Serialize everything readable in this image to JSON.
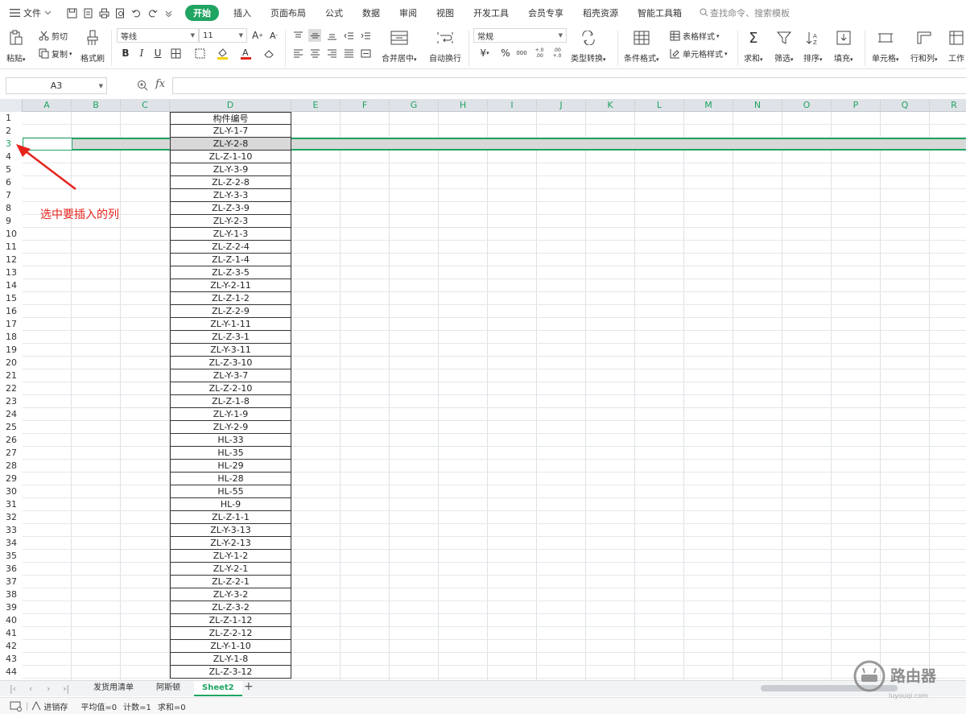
{
  "menubar": {
    "file_label": "文件",
    "tabs": [
      "开始",
      "插入",
      "页面布局",
      "公式",
      "数据",
      "审阅",
      "视图",
      "开发工具",
      "会员专享",
      "稻壳资源",
      "智能工具箱"
    ],
    "active_tab": "开始",
    "search_placeholder": "查找命令、搜索模板"
  },
  "ribbon": {
    "paste": "粘贴",
    "cut": "剪切",
    "copy": "复制",
    "format_painter": "格式刷",
    "font_name": "等线",
    "font_size": "11",
    "merge_center": "合并居中",
    "wrap_text": "自动换行",
    "number_format": "常规",
    "type_convert": "类型转换",
    "conditional_format": "条件格式",
    "table_style": "表格样式",
    "cell_style": "单元格样式",
    "sum": "求和",
    "filter": "筛选",
    "sort": "排序",
    "fill": "填充",
    "cell": "单元格",
    "rows_cols": "行和列",
    "worksheet": "工作",
    "bold": "B",
    "italic": "I",
    "underline": "U",
    "currency": "¥",
    "percent": "%",
    "thousands": "000",
    "inc_decimal": "+.0 .00",
    "dec_decimal": ".00 +.0"
  },
  "formula_bar": {
    "name_box": "A3",
    "fx": "fx",
    "value": ""
  },
  "grid": {
    "columns": [
      "A",
      "B",
      "C",
      "D",
      "E",
      "F",
      "G",
      "H",
      "I",
      "J",
      "K",
      "L",
      "M",
      "N",
      "O",
      "P",
      "Q",
      "R"
    ],
    "rows": [
      "1",
      "2",
      "3",
      "4",
      "5",
      "6",
      "7",
      "8",
      "9",
      "10",
      "11",
      "12",
      "13",
      "14",
      "15",
      "16",
      "17",
      "18",
      "19",
      "20",
      "21",
      "22",
      "23",
      "24",
      "25",
      "26",
      "27",
      "28",
      "29",
      "30",
      "31",
      "32",
      "33",
      "34",
      "35",
      "36",
      "37",
      "38",
      "39",
      "40",
      "41",
      "42",
      "43",
      "44"
    ],
    "column_d_values": [
      "构件编号",
      "ZL-Y-1-7",
      "ZL-Y-2-8",
      "ZL-Z-1-10",
      "ZL-Y-3-9",
      "ZL-Z-2-8",
      "ZL-Y-3-3",
      "ZL-Z-3-9",
      "ZL-Y-2-3",
      "ZL-Y-1-3",
      "ZL-Z-2-4",
      "ZL-Z-1-4",
      "ZL-Z-3-5",
      "ZL-Y-2-11",
      "ZL-Z-1-2",
      "ZL-Z-2-9",
      "ZL-Y-1-11",
      "ZL-Z-3-1",
      "ZL-Y-3-11",
      "ZL-Z-3-10",
      "ZL-Y-3-7",
      "ZL-Z-2-10",
      "ZL-Z-1-8",
      "ZL-Y-1-9",
      "ZL-Y-2-9",
      "HL-33",
      "HL-35",
      "HL-29",
      "HL-28",
      "HL-55",
      "HL-9",
      "ZL-Z-1-1",
      "ZL-Y-3-13",
      "ZL-Y-2-13",
      "ZL-Y-1-2",
      "ZL-Y-2-1",
      "ZL-Z-2-1",
      "ZL-Y-3-2",
      "ZL-Z-3-2",
      "ZL-Z-1-12",
      "ZL-Z-2-12",
      "ZL-Y-1-10",
      "ZL-Y-1-8",
      "ZL-Z-3-12"
    ],
    "selected_row": "3",
    "annotation": "选中要插入的列"
  },
  "sheet_tabs": {
    "nav": [
      "|<",
      "<",
      ">",
      ">|"
    ],
    "tabs": [
      "发货用清单",
      "阿斯顿",
      "Sheet2"
    ],
    "active": "Sheet2",
    "add": "+"
  },
  "status_bar": {
    "macro": "进销存",
    "average": "平均值=0",
    "count": "计数=1",
    "sum": "求和=0"
  },
  "watermark": {
    "text": "路由器",
    "url": "luyouqi.com"
  },
  "colors": {
    "accent": "#1fa461",
    "annotation": "#e5241c",
    "header_bg": "#dfe3e8"
  }
}
